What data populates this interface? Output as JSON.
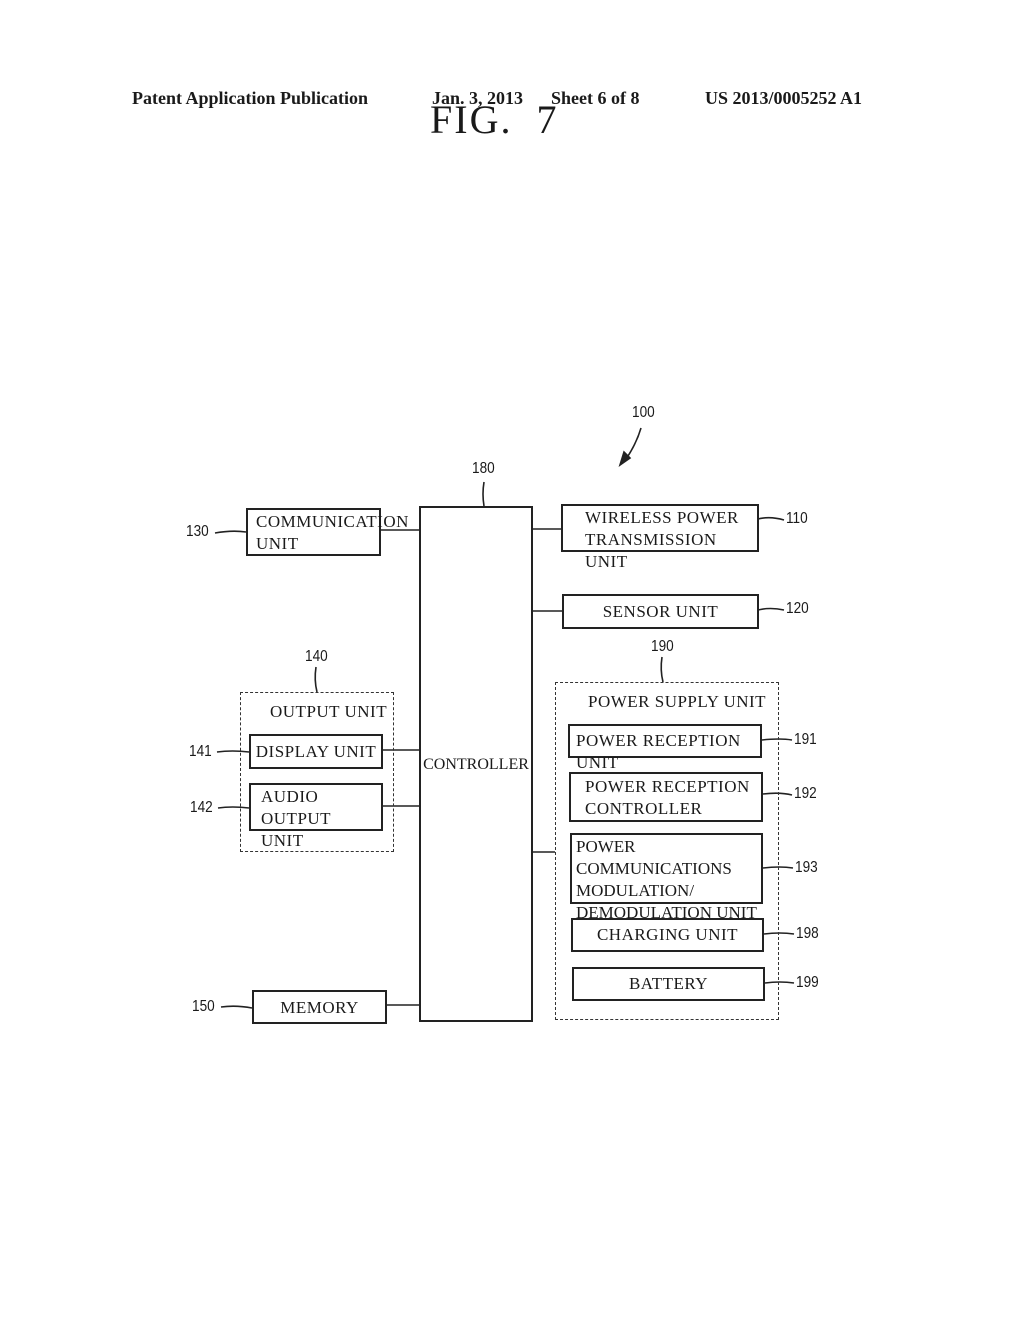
{
  "header": {
    "publication": "Patent Application Publication",
    "date": "Jan. 3, 2013",
    "sheet": "Sheet 6 of 8",
    "number": "US 2013/0005252 A1"
  },
  "figure": {
    "title": "FIG.  7",
    "system_ref": "100"
  },
  "blocks": {
    "controller": {
      "ref": "180",
      "label": "CONTROLLER"
    },
    "communication": {
      "ref": "130",
      "line1": "COMMUNICATION",
      "line2": "UNIT"
    },
    "wireless_power": {
      "ref": "110",
      "line1": "WIRELESS POWER",
      "line2": "TRANSMISSION UNIT"
    },
    "sensor": {
      "ref": "120",
      "label": "SENSOR UNIT"
    },
    "output_unit": {
      "ref": "140",
      "title": "OUTPUT UNIT",
      "display": {
        "ref": "141",
        "label": "DISPLAY UNIT"
      },
      "audio": {
        "ref": "142",
        "line1": "AUDIO OUTPUT",
        "line2": "UNIT"
      }
    },
    "memory": {
      "ref": "150",
      "label": "MEMORY"
    },
    "power_supply": {
      "ref": "190",
      "title": "POWER SUPPLY UNIT",
      "reception_unit": {
        "ref": "191",
        "label": "POWER RECEPTION UNIT"
      },
      "reception_controller": {
        "ref": "192",
        "line1": "POWER RECEPTION",
        "line2": "CONTROLLER"
      },
      "modem": {
        "ref": "193",
        "line1": "POWER COMMUNICATIONS",
        "line2": "MODULATION/",
        "line3": "DEMODULATION UNIT"
      },
      "charging": {
        "ref": "198",
        "label": "CHARGING UNIT"
      },
      "battery": {
        "ref": "199",
        "label": "BATTERY"
      }
    }
  }
}
